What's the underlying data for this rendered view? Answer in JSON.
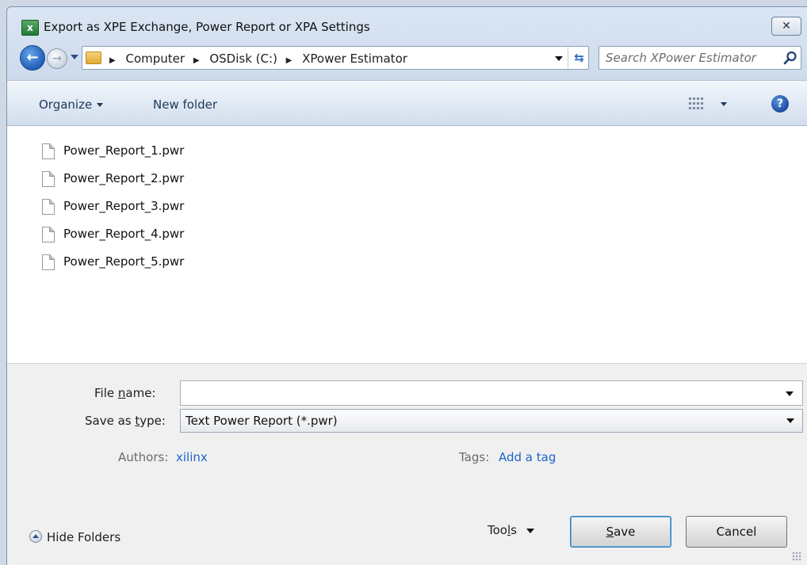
{
  "window": {
    "title": "Export as XPE Exchange, Power Report or XPA Settings",
    "close_glyph": "✕",
    "app_icon": "excel-icon"
  },
  "navigation": {
    "breadcrumbs": [
      "Computer",
      "OSDisk (C:)",
      "XPower Estimator"
    ],
    "search_placeholder": "Search XPower Estimator"
  },
  "toolbar": {
    "organize_label": "Organize",
    "new_folder_label": "New folder",
    "help_glyph": "?"
  },
  "files": [
    "Power_Report_1.pwr",
    "Power_Report_2.pwr",
    "Power_Report_3.pwr",
    "Power_Report_4.pwr",
    "Power_Report_5.pwr"
  ],
  "form": {
    "file_name_label_pre": "File ",
    "file_name_label_key": "n",
    "file_name_label_post": "ame:",
    "file_name_value": "",
    "save_type_label_pre": "Save as ",
    "save_type_label_key": "t",
    "save_type_label_post": "ype:",
    "save_type_value": "Text Power Report (*.pwr)",
    "authors_label": "Authors:",
    "authors_value": "xilinx",
    "tags_label": "Tags:",
    "tags_value": "Add a tag"
  },
  "footer": {
    "hide_folders_label": "Hide Folders",
    "tools_label_pre": "Too",
    "tools_label_key": "l",
    "tools_label_post": "s",
    "save_key": "S",
    "save_rest": "ave",
    "cancel_label": "Cancel"
  },
  "colors": {
    "link": "#1a66c9",
    "accent": "#1f5fb8"
  }
}
